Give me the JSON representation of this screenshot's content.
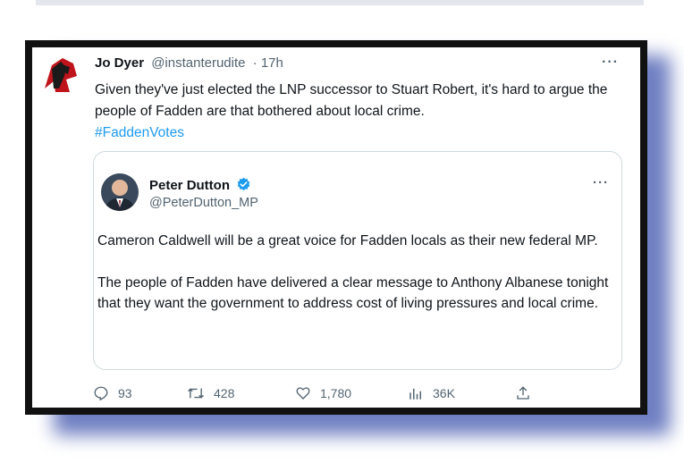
{
  "tweet": {
    "author_name": "Jo Dyer",
    "author_handle": "@instanterudite",
    "time": "· 17h",
    "more": "···",
    "text": "Given they've just elected the LNP successor to Stuart Robert, it's hard to argue the people of Fadden are that bothered about local crime.",
    "hashtag": "#FaddenVotes"
  },
  "quote": {
    "author_name": "Peter Dutton",
    "author_handle": "@PeterDutton_MP",
    "more": "···",
    "paragraph_1": "Cameron Caldwell will be a great voice for Fadden locals as their new federal MP.",
    "paragraph_2": "The people of Fadden have delivered a clear message to Anthony Albanese tonight that they want the government to address cost of living pressures and local crime."
  },
  "actions": {
    "replies": "93",
    "retweets": "428",
    "likes": "1,780",
    "views": "36K"
  },
  "icons": [
    "reply-icon",
    "retweet-icon",
    "like-icon",
    "views-icon",
    "share-icon",
    "verified-icon"
  ],
  "colors": {
    "link": "#1d9bf0",
    "verified": "#1d9bf0",
    "muted": "#536471",
    "backdrop": "#6f7fc2"
  }
}
